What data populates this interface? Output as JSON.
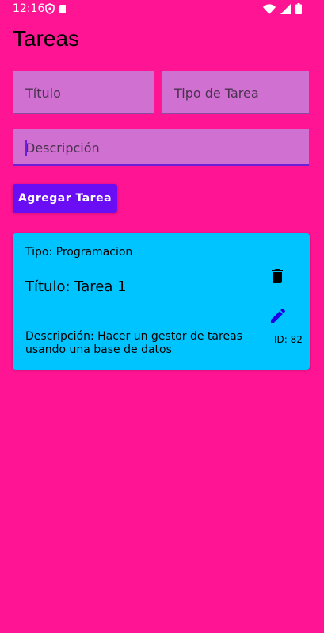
{
  "status_bar": {
    "time": "12:16",
    "left_icons": [
      "shield-icon",
      "sd-card-icon"
    ],
    "right_icons": [
      "wifi-icon",
      "signal-icon",
      "battery-icon"
    ]
  },
  "app": {
    "title": "Tareas"
  },
  "form": {
    "title_placeholder": "Título",
    "type_placeholder": "Tipo de Tarea",
    "description_placeholder": "Descripción",
    "add_button_label": "Agregar Tarea"
  },
  "tasks": [
    {
      "type": "Tipo: Programacion",
      "title": "Título: Tarea 1",
      "description": "Descripción: Hacer un gestor de tareas usando una base de datos",
      "id": "ID: 82"
    }
  ],
  "colors": {
    "background": "#FF1493",
    "field": "#D070D0",
    "button": "#6A0DF5",
    "card": "#00C4FF",
    "edit_icon": "#1E00E6"
  }
}
